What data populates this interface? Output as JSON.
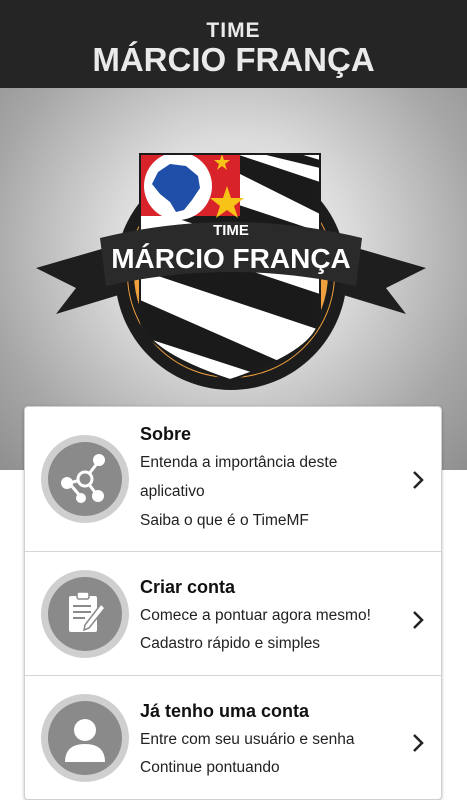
{
  "header": {
    "small_title": "TIME",
    "big_title": "MÁRCIO FRANÇA"
  },
  "logo": {
    "ribbon_small": "TIME",
    "ribbon_big": "MÁRCIO FRANÇA"
  },
  "menu": [
    {
      "title": "Sobre",
      "lines": [
        "Entenda a importância deste",
        "aplicativo",
        "Saiba o que é o TimeMF"
      ],
      "icon": "share-network-icon"
    },
    {
      "title": "Criar conta",
      "lines": [
        "Comece a pontuar agora mesmo!",
        "Cadastro rápido e simples"
      ],
      "icon": "clipboard-pen-icon"
    },
    {
      "title": "Já tenho uma conta",
      "lines": [
        "Entre com seu usuário e senha",
        "Continue pontuando"
      ],
      "icon": "user-icon"
    }
  ],
  "colors": {
    "header_bg": "#252525",
    "accent_orange": "#f0a03c",
    "flag_red": "#d8232a",
    "brazil_blue": "#1f4fa8",
    "star_yellow": "#f7c316"
  }
}
